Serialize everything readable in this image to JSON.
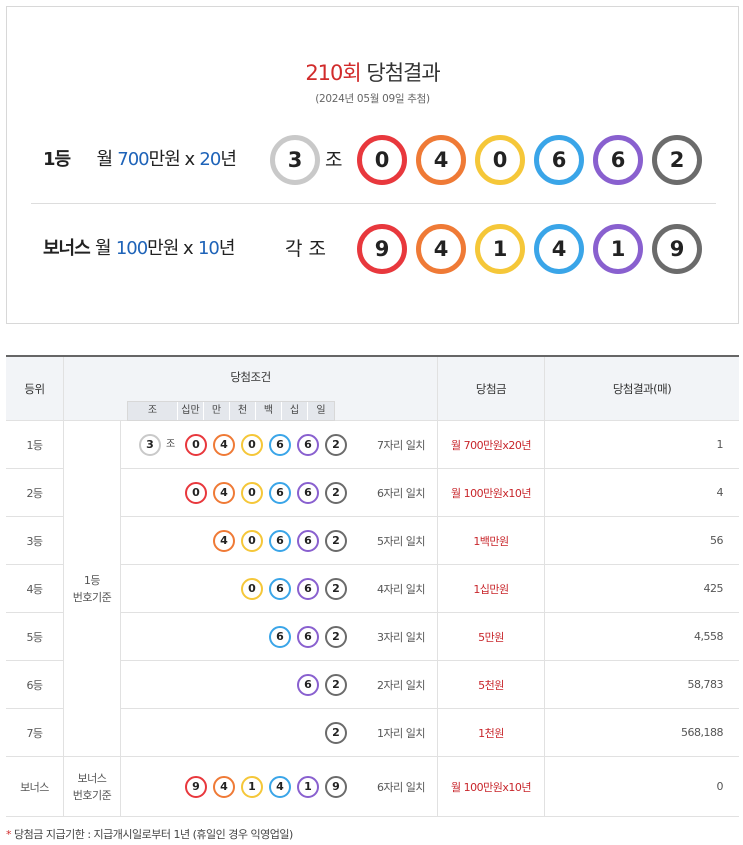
{
  "header": {
    "round": "210회",
    "title": "당첨결과",
    "draw_date": "(2024년 05월 09일 추첨)"
  },
  "first_prize": {
    "rank_label": "1등",
    "prefix": "월",
    "amount": "700",
    "unit": "만원 x",
    "years": "20",
    "years_unit": "년",
    "group": "3",
    "jo_label": "조",
    "numbers": [
      "0",
      "4",
      "0",
      "6",
      "6",
      "2"
    ]
  },
  "bonus_prize": {
    "rank_label": "보너스",
    "prefix": "월",
    "amount": "100",
    "unit": "만원 x",
    "years": "10",
    "years_unit": "년",
    "group_label": "각 조",
    "numbers": [
      "9",
      "4",
      "1",
      "4",
      "1",
      "9"
    ]
  },
  "table": {
    "headers": {
      "rank": "등위",
      "condition": "당첨조건",
      "prize": "당첨금",
      "count": "당첨결과(매)"
    },
    "digit_headers": [
      "조",
      "십만",
      "만",
      "천",
      "백",
      "십",
      "일"
    ],
    "basis_first": "1등\n번호기준",
    "basis_bonus": "보너스\n번호기준",
    "rows": [
      {
        "rank": "1등",
        "match": "7자리 일치",
        "prize": "월 700만원x20년",
        "count": "1",
        "group": "3",
        "jo": "조",
        "balls": [
          "0",
          "4",
          "0",
          "6",
          "6",
          "2"
        ]
      },
      {
        "rank": "2등",
        "match": "6자리 일치",
        "prize": "월 100만원x10년",
        "count": "4",
        "balls": [
          "0",
          "4",
          "0",
          "6",
          "6",
          "2"
        ]
      },
      {
        "rank": "3등",
        "match": "5자리 일치",
        "prize": "1백만원",
        "count": "56",
        "balls": [
          "4",
          "0",
          "6",
          "6",
          "2"
        ]
      },
      {
        "rank": "4등",
        "match": "4자리 일치",
        "prize": "1십만원",
        "count": "425",
        "balls": [
          "0",
          "6",
          "6",
          "2"
        ]
      },
      {
        "rank": "5등",
        "match": "3자리 일치",
        "prize": "5만원",
        "count": "4,558",
        "balls": [
          "6",
          "6",
          "2"
        ]
      },
      {
        "rank": "6등",
        "match": "2자리 일치",
        "prize": "5천원",
        "count": "58,783",
        "balls": [
          "6",
          "2"
        ]
      },
      {
        "rank": "7등",
        "match": "1자리 일치",
        "prize": "1천원",
        "count": "568,188",
        "balls": [
          "2"
        ]
      },
      {
        "rank": "보너스",
        "match": "6자리 일치",
        "prize": "월 100만원x10년",
        "count": "0",
        "balls": [
          "9",
          "4",
          "1",
          "4",
          "1",
          "9"
        ]
      }
    ]
  },
  "footnote": {
    "mark": "*",
    "text": "당첨금 지급기한 : 지급개시일로부터 1년 (휴일인 경우 익영업일)"
  },
  "colors": {
    "red": "#e8383d",
    "orange": "#ef7a36",
    "yellow": "#f5c739",
    "blue": "#3aa5e8",
    "purple": "#8960cf",
    "gray": "#6b6b6b",
    "silver": "#c9c9c9",
    "accent_red": "#d12b2b",
    "accent_blue": "#1e63b8"
  }
}
